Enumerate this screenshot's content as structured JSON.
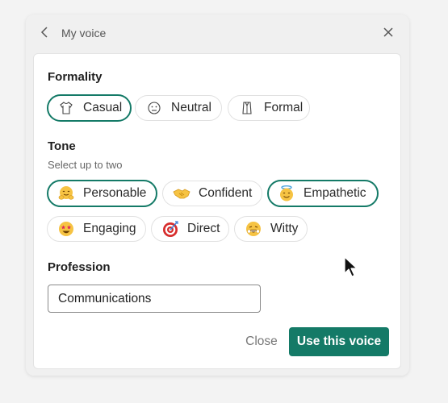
{
  "header": {
    "title": "My voice"
  },
  "formality": {
    "title": "Formality",
    "options": [
      {
        "label": "Casual",
        "icon": "tshirt-icon",
        "selected": true
      },
      {
        "label": "Neutral",
        "icon": "neutral-face-icon",
        "selected": false
      },
      {
        "label": "Formal",
        "icon": "dress-shirt-icon",
        "selected": false
      }
    ]
  },
  "tone": {
    "title": "Tone",
    "hint": "Select up to two",
    "options": [
      {
        "label": "Personable",
        "icon": "hugging-face-icon",
        "selected": true
      },
      {
        "label": "Confident",
        "icon": "handshake-icon",
        "selected": false
      },
      {
        "label": "Empathetic",
        "icon": "halo-face-icon",
        "selected": true
      },
      {
        "label": "Engaging",
        "icon": "star-struck-face-icon",
        "selected": false
      },
      {
        "label": "Direct",
        "icon": "target-icon",
        "selected": false
      },
      {
        "label": "Witty",
        "icon": "laughing-face-icon",
        "selected": false
      }
    ]
  },
  "profession": {
    "title": "Profession",
    "value": "Communications"
  },
  "actions": {
    "close_label": "Close",
    "primary_label": "Use this voice"
  },
  "colors": {
    "accent": "#147a67",
    "background": "#f3f3f3",
    "card": "#ffffff"
  }
}
